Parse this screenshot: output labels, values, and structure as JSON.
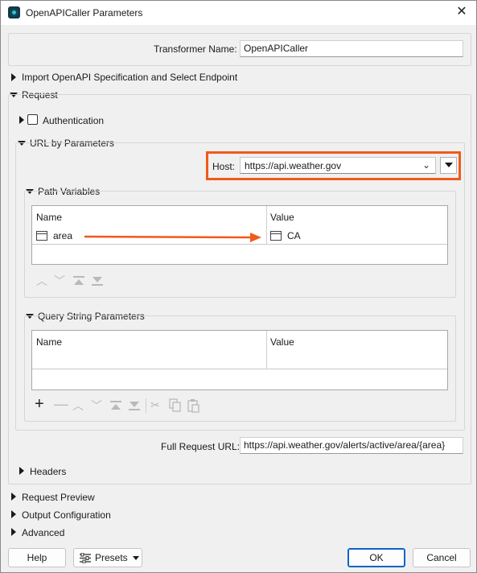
{
  "window": {
    "title": "OpenAPICaller Parameters"
  },
  "transformer": {
    "label": "Transformer Name:",
    "value": "OpenAPICaller"
  },
  "sections": {
    "import": "Import OpenAPI Specification and Select Endpoint",
    "request": "Request",
    "authentication": "Authentication",
    "url_by_params": "URL by Parameters",
    "path_variables": "Path Variables",
    "query_params": "Query String Parameters",
    "headers": "Headers",
    "request_preview": "Request Preview",
    "output_config": "Output Configuration",
    "advanced": "Advanced"
  },
  "host": {
    "label": "Host:",
    "value": "https://api.weather.gov"
  },
  "path_table": {
    "columns": [
      "Name",
      "Value"
    ],
    "rows": [
      {
        "name": "area",
        "value": "CA"
      }
    ]
  },
  "query_table": {
    "columns": [
      "Name",
      "Value"
    ],
    "rows": []
  },
  "full_url": {
    "label": "Full Request URL:",
    "value": "https://api.weather.gov/alerts/active/area/{area}"
  },
  "buttons": {
    "help": "Help",
    "presets": "Presets",
    "ok": "OK",
    "cancel": "Cancel"
  },
  "colors": {
    "highlight": "#f05a1a",
    "ok_border": "#0a64c8"
  },
  "icons": {
    "close": "close-icon",
    "app": "app-icon",
    "path_toolbar": [
      "move-up-icon",
      "move-down-icon",
      "move-top-icon",
      "move-bottom-icon"
    ],
    "query_toolbar": [
      "add-icon",
      "remove-icon",
      "move-up-icon",
      "move-down-icon",
      "move-top-icon",
      "move-bottom-icon",
      "cut-icon",
      "copy-icon",
      "paste-icon"
    ]
  }
}
